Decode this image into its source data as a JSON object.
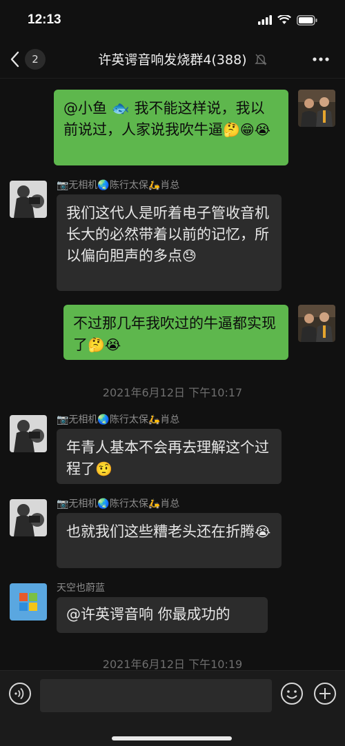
{
  "status_bar": {
    "time": "12:13"
  },
  "nav": {
    "back_count": "2",
    "title": "许英谔音响发烧群4(388)"
  },
  "messages": [
    {
      "side": "me",
      "text": "@小鱼 🐟 我不能这样说，我以前说过，人家说我吹牛逼",
      "emojis": "🤔😁😭"
    },
    {
      "side": "other",
      "sender": "📷无相机🌏陈行太保🛵肖总",
      "text": "我们这代人是听着电子管收音机长大的必然带着以前的记忆，所以偏向胆声的多点",
      "emojis": "😓"
    },
    {
      "side": "me",
      "text": "不过那几年我吹过的牛逼都实现了",
      "emojis": "🤔😭"
    },
    {
      "side": "other",
      "sender": "📷无相机🌏陈行太保🛵肖总",
      "text": "年青人基本不会再去理解这个过程了",
      "emojis": "🤨"
    },
    {
      "side": "other",
      "sender": "📷无相机🌏陈行太保🛵肖总",
      "text": "也就我们这些糟老头还在折腾",
      "emojis": "😭"
    },
    {
      "side": "other",
      "sender": "天空也蔚蓝",
      "text": "@许英谔音响 你最成功的",
      "emojis": ""
    }
  ],
  "timestamps": [
    "2021年6月12日 下午10:17",
    "2021年6月12日 下午10:19"
  ],
  "input": {
    "value": ""
  }
}
